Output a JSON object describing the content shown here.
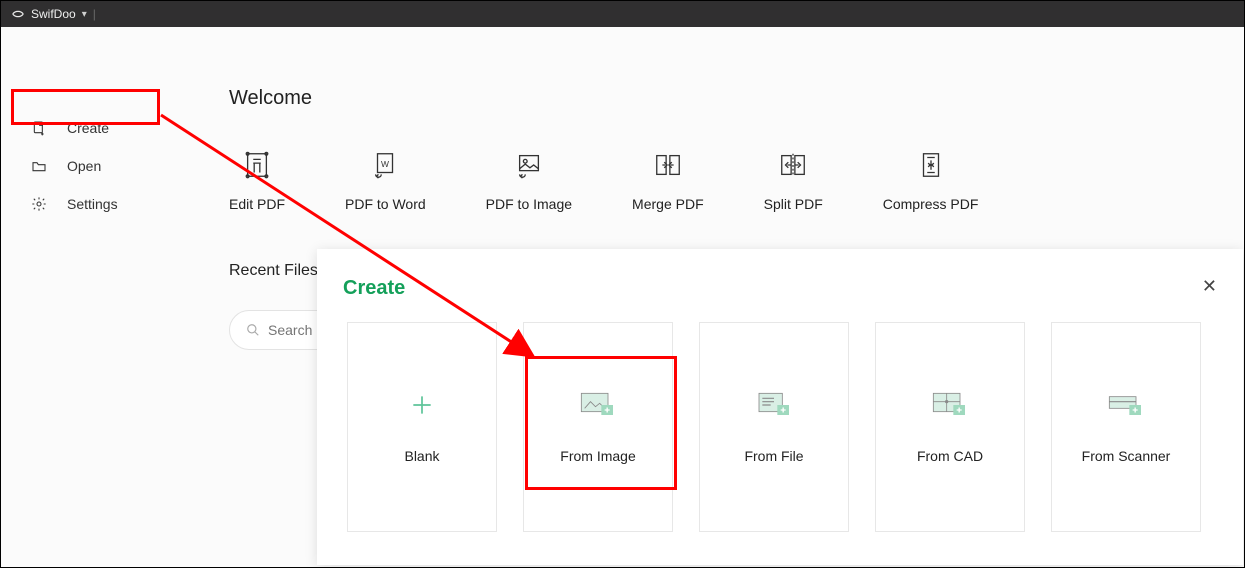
{
  "titlebar": {
    "app_name": "SwifDoo"
  },
  "sidebar": {
    "items": [
      {
        "label": "Create"
      },
      {
        "label": "Open"
      },
      {
        "label": "Settings"
      }
    ]
  },
  "main": {
    "welcome": "Welcome",
    "actions": [
      {
        "label": "Edit PDF"
      },
      {
        "label": "PDF to Word"
      },
      {
        "label": "PDF to Image"
      },
      {
        "label": "Merge PDF"
      },
      {
        "label": "Split PDF"
      },
      {
        "label": "Compress PDF"
      }
    ],
    "recent_title": "Recent Files",
    "search_placeholder": "Search in"
  },
  "create_panel": {
    "title": "Create",
    "cards": [
      {
        "label": "Blank"
      },
      {
        "label": "From Image"
      },
      {
        "label": "From File"
      },
      {
        "label": "From CAD"
      },
      {
        "label": "From Scanner"
      }
    ]
  }
}
